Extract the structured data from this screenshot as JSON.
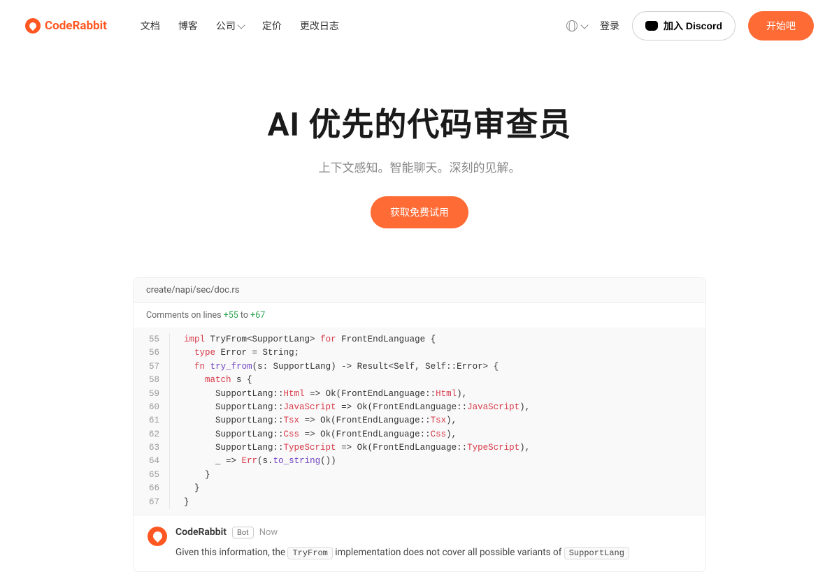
{
  "brand": "CodeRabbit",
  "nav": {
    "docs": "文档",
    "blog": "博客",
    "company": "公司",
    "pricing": "定价",
    "changelog": "更改日志"
  },
  "actions": {
    "login": "登录",
    "discord": "加入 Discord",
    "start": "开始吧"
  },
  "hero": {
    "title": "AI 优先的代码审查员",
    "subtitle": "上下文感知。智能聊天。深刻的见解。",
    "cta": "获取免费试用"
  },
  "file": {
    "path": "create/napi/sec/doc.rs",
    "comment_prefix": "Comments on lines ",
    "line_from": "+55",
    "line_to": "+67",
    "to_word": " to "
  },
  "code": {
    "lines": [
      "55",
      "56",
      "57",
      "58",
      "59",
      "60",
      "61",
      "62",
      "63",
      "64",
      "65",
      "66",
      "67"
    ]
  },
  "review": {
    "author": "CodeRabbit",
    "bot_label": "Bot",
    "time": "Now",
    "text_prefix": "Given this information, the ",
    "code1": "TryFrom",
    "text_mid": " implementation does not cover all possible variants of ",
    "code2": "SupportLang"
  }
}
